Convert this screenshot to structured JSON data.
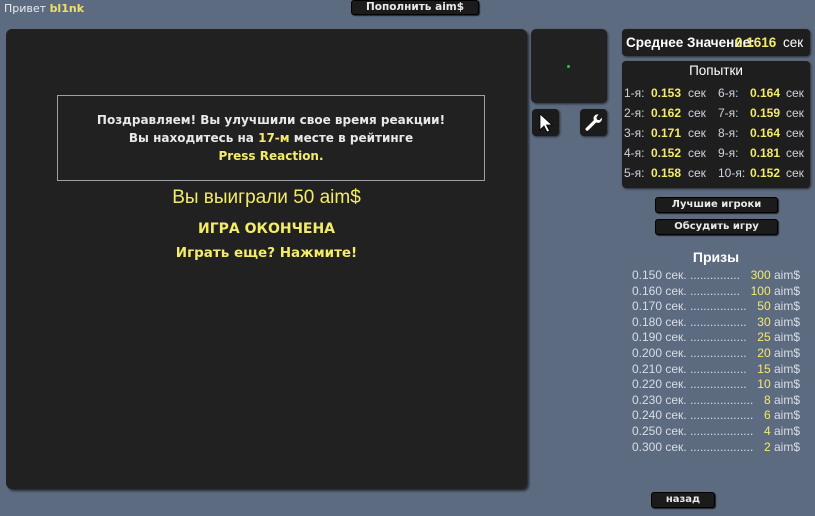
{
  "header": {
    "greeting": "Привет",
    "username": "bl1nk",
    "topup_label": "Пополнить aim$"
  },
  "message": {
    "line1": "Поздравляем! Вы улучшили свое время реакции!",
    "line2_prefix": "Вы находитесь на",
    "rank": "17-м",
    "line2_suffix": "месте в рейтинге",
    "line3": "Press Reaction."
  },
  "result": {
    "won": "Вы выиграли 50 aim$",
    "game_over": "ИГРА ОКОНЧЕНА",
    "play_again": "Играть еще? Нажмите!"
  },
  "average": {
    "label": "Среднее Значение:",
    "value": "0.1616",
    "unit": "сек"
  },
  "attempts": {
    "title": "Попытки",
    "unit": "сек",
    "items": [
      {
        "label": "1-я:",
        "value": "0.153"
      },
      {
        "label": "2-я:",
        "value": "0.162"
      },
      {
        "label": "3-я:",
        "value": "0.171"
      },
      {
        "label": "4-я:",
        "value": "0.152"
      },
      {
        "label": "5-я:",
        "value": "0.158"
      },
      {
        "label": "6-я:",
        "value": "0.164"
      },
      {
        "label": "7-я:",
        "value": "0.159"
      },
      {
        "label": "8-я:",
        "value": "0.164"
      },
      {
        "label": "9-я:",
        "value": "0.181"
      },
      {
        "label": "10-я:",
        "value": "0.152"
      }
    ]
  },
  "buttons": {
    "best_players": "Лучшие игроки",
    "discuss": "Обсудить игру",
    "back": "назад"
  },
  "prizes": {
    "title": "Призы",
    "items": [
      {
        "time": "0.150 сек. ...............",
        "amount": "300",
        "currency": "aim$"
      },
      {
        "time": "0.160 сек. ...............",
        "amount": "100",
        "currency": "aim$"
      },
      {
        "time": "0.170 сек. .................",
        "amount": "50",
        "currency": "aim$"
      },
      {
        "time": "0.180 сек. .................",
        "amount": "30",
        "currency": "aim$"
      },
      {
        "time": "0.190 сек. .................",
        "amount": "25",
        "currency": "aim$"
      },
      {
        "time": "0.200 сек. .................",
        "amount": "20",
        "currency": "aim$"
      },
      {
        "time": "0.210 сек. .................",
        "amount": "15",
        "currency": "aim$"
      },
      {
        "time": "0.220 сек. .................",
        "amount": "10",
        "currency": "aim$"
      },
      {
        "time": "0.230 сек. ...................",
        "amount": "8",
        "currency": "aim$"
      },
      {
        "time": "0.240 сек. ...................",
        "amount": "6",
        "currency": "aim$"
      },
      {
        "time": "0.250 сек. ...................",
        "amount": "4",
        "currency": "aim$"
      },
      {
        "time": "0.300 сек. ...................",
        "amount": "2",
        "currency": "aim$"
      }
    ]
  },
  "colors": {
    "background": "#5d6b80",
    "panel": "#212121",
    "accent": "#f4eb6a",
    "target_dot": "#22cc33"
  },
  "icons": {
    "pointer": "cursor-arrow-icon",
    "settings": "wrench-icon"
  }
}
